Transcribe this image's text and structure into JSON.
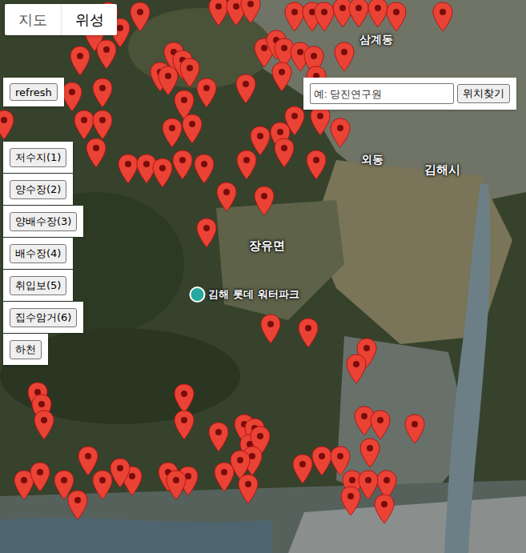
{
  "map_type": [
    {
      "label": "지도",
      "selected": false
    },
    {
      "label": "위성",
      "selected": true
    }
  ],
  "refresh": {
    "label": "refresh"
  },
  "search": {
    "placeholder": "예: 당진연구원",
    "button": "위치찾기"
  },
  "layers": [
    {
      "label": "저수지(1)"
    },
    {
      "label": "양수장(2)"
    },
    {
      "label": "양배수장(3)"
    },
    {
      "label": "배수장(4)"
    },
    {
      "label": "취입보(5)"
    },
    {
      "label": "집수암거(6)"
    },
    {
      "label": "하천"
    }
  ],
  "map_labels": [
    {
      "text": "삼계동",
      "kind": "place"
    },
    {
      "text": "외동",
      "kind": "place"
    },
    {
      "text": "김해시",
      "kind": "city"
    },
    {
      "text": "장유면",
      "kind": "city"
    },
    {
      "text": "김해 롯데 워터파크",
      "kind": "poi"
    }
  ]
}
